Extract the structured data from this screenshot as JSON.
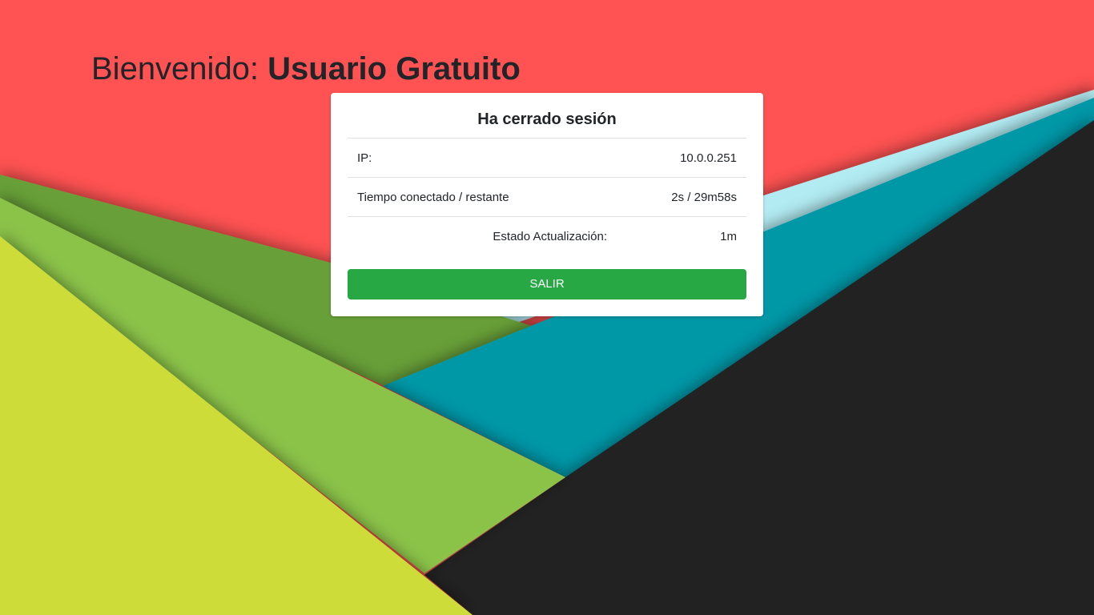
{
  "header": {
    "welcome_label": "Bienvenido:",
    "user_name": "Usuario Gratuito"
  },
  "card": {
    "title": "Ha cerrado sesión",
    "rows": [
      {
        "label": "IP:",
        "value": "10.0.0.251"
      },
      {
        "label": "Tiempo conectado / restante",
        "value": "2s / 29m58s"
      },
      {
        "label": "Estado Actualización:",
        "value": "1m"
      }
    ],
    "button_label": "SALIR"
  },
  "colors": {
    "background_red": "#ff5252",
    "dark_green": "#689f38",
    "light_green": "#8bc34a",
    "lime": "#cddc39",
    "teal": "#0097a7",
    "light_cyan": "#b2ebf2",
    "dark": "#212121",
    "button_green": "#28a745"
  }
}
